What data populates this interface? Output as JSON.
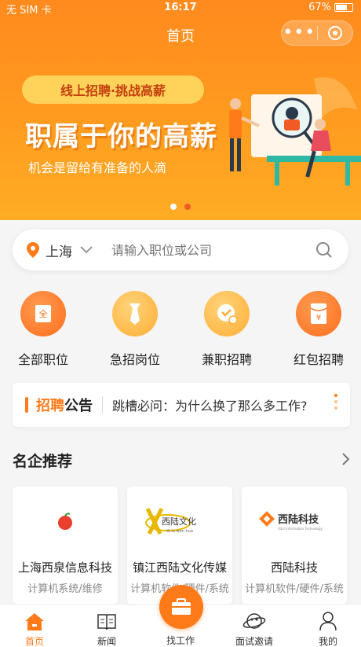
{
  "status_bar": {
    "carrier": "无 SIM 卡",
    "time": "16:17",
    "battery": "67%"
  },
  "nav": {
    "title": "首页"
  },
  "banner": {
    "pill": "线上招聘·挑战高薪",
    "headline": "职属于你的高薪",
    "slogan": "机会是留给有准备的人滴",
    "active_slide": 2,
    "slide_count": 2
  },
  "search": {
    "city": "上海",
    "placeholder": "请输入职位或公司"
  },
  "categories": [
    {
      "label": "全部职位",
      "icon": "document-icon",
      "color": "#ff7a2a"
    },
    {
      "label": "急招岗位",
      "icon": "tie-icon",
      "color": "#ffb340"
    },
    {
      "label": "兼职招聘",
      "icon": "clock-icon",
      "color": "#ffb340"
    },
    {
      "label": "红包招聘",
      "icon": "red-envelope-icon",
      "color": "#ff7a2a"
    }
  ],
  "notice": {
    "label_highlight": "招聘",
    "label_rest": "公告",
    "message": "跳槽必问：为什么换了那么多工作?"
  },
  "featured": {
    "title": "名企推荐",
    "companies": [
      {
        "name": "上海西泉信息科技",
        "industry": "计算机系统/维修",
        "logo": "apple-logo"
      },
      {
        "name": "镇江西陆文化传媒",
        "industry": "计算机软件/硬件/系统",
        "logo": "xilu-culture-logo",
        "logo_text": "西陆文化",
        "logo_sub": "Xi lu wen hua"
      },
      {
        "name": "西陆科技",
        "industry": "计算机软件/硬件/系统",
        "logo": "xilu-tech-logo",
        "logo_text": "西陆科技",
        "logo_sub": "XiLU Information Technology"
      }
    ]
  },
  "tabbar": {
    "home": "首页",
    "news": "新闻",
    "jobs": "找工作",
    "interview": "面试邀请",
    "mine": "我的"
  },
  "colors": {
    "brand": "#ff7b1a",
    "accent": "#f15a22"
  }
}
